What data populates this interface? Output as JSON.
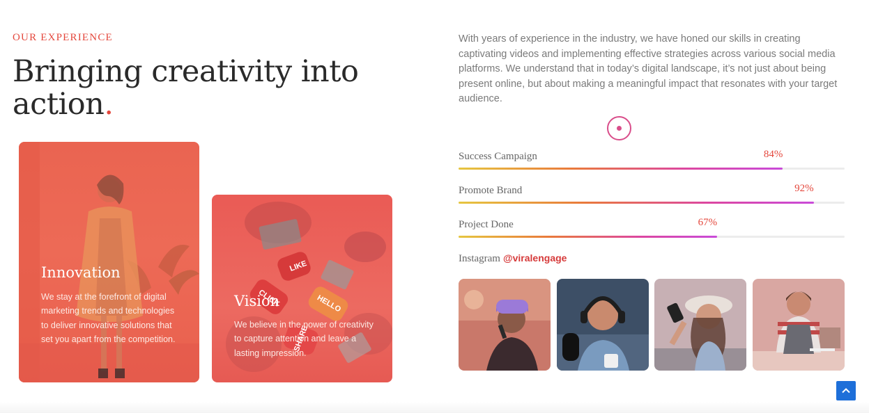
{
  "experience": {
    "eyebrow": "OUR EXPERIENCE",
    "headline": "Bringing creativity into action",
    "headline_dot": "."
  },
  "cards": [
    {
      "title": "Innovation",
      "text": "We stay at the forefront of digital marketing trends and technologies to deliver innovative solutions that set you apart from the competition."
    },
    {
      "title": "Vision",
      "text": "We believe in the power of creativity to capture attention and leave a lasting impression.",
      "bubbles": [
        "LIKE",
        "CLICK",
        "HELLO",
        "SHARE"
      ]
    }
  ],
  "intro": "With years of experience in the industry, we have honed our skills in creating captivating videos and implementing effective strategies across various social media platforms. We understand that in today’s digital landscape, it’s not just about being present online, but about making a meaningful impact that resonates with your target audience.",
  "skills": [
    {
      "label": "Success Campaign",
      "value": 84,
      "display": "84%"
    },
    {
      "label": "Promote Brand",
      "value": 92,
      "display": "92%"
    },
    {
      "label": "Project Done",
      "value": 67,
      "display": "67%"
    }
  ],
  "instagram": {
    "label": "Instagram",
    "handle": "@viralengage",
    "photos": [
      "singer-photo",
      "podcaster-photo",
      "selfie-photo",
      "cooking-photo"
    ]
  },
  "scroll_top_icon": "chevron-up-icon",
  "colors": {
    "accent": "#e4473c",
    "ring": "#d94d8a",
    "scroll_button": "#1e6fd9"
  }
}
